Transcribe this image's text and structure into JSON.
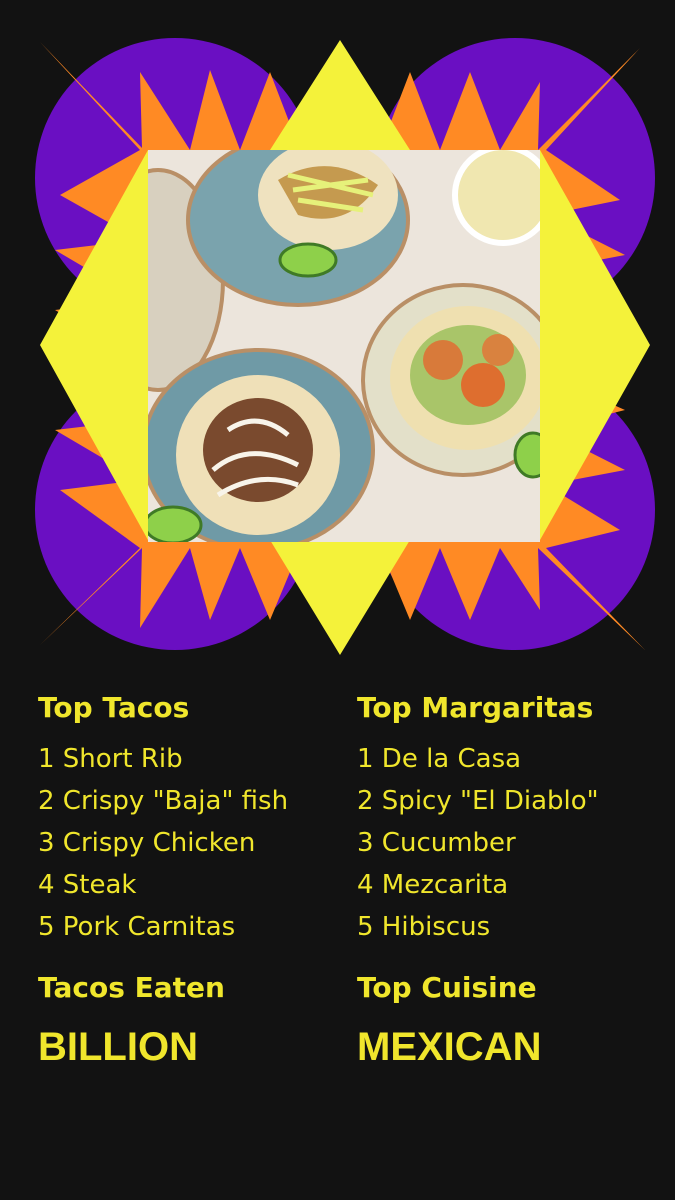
{
  "colors": {
    "background": "#121212",
    "text_yellow": "#f0e62c",
    "burst_purple": "#6a0fc2",
    "burst_orange": "#ff8a24",
    "burst_yellow": "#f4f23a"
  },
  "hero": {
    "image_description": "Overhead photo of tacos on turquoise and cream plates with lime wedges and a margarita",
    "icon": "starburst-frame"
  },
  "left_column": {
    "top_heading": "Top Tacos",
    "items": [
      "1 Short Rib",
      "2 Crispy \"Baja\" fish",
      "3 Crispy Chicken",
      "4 Steak",
      "5 Pork Carnitas"
    ],
    "stat_heading": "Tacos Eaten",
    "stat_value": "BILLION"
  },
  "right_column": {
    "top_heading": "Top Margaritas",
    "items": [
      "1 De la Casa",
      "2 Spicy \"El Diablo\"",
      "3 Cucumber",
      "4 Mezcarita",
      "5 Hibiscus"
    ],
    "stat_heading": "Top Cuisine",
    "stat_value": "MEXICAN"
  }
}
